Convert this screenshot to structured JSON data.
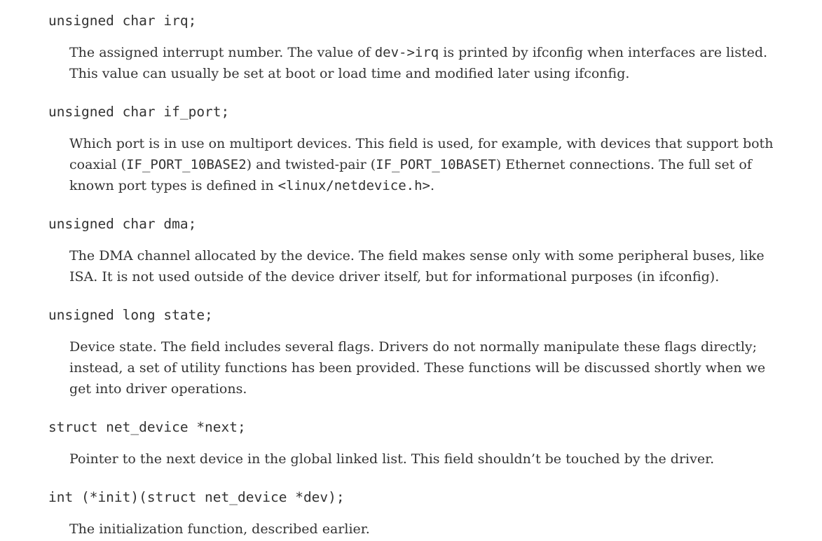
{
  "entries": [
    {
      "term": "unsigned char irq;",
      "lines": [
        [
          "The assigned interrupt number. The value of ",
          "dev->irq",
          " is printed by ifconfig when interfaces are listed."
        ],
        [
          "This value can usually be set at boot or load time and modified later using ifconfig."
        ]
      ]
    },
    {
      "term": "unsigned char if_port;",
      "lines": [
        [
          "Which port is in use on multiport devices. This field is used, for example, with devices that support both"
        ],
        [
          "coaxial (",
          "IF_PORT_10BASE2",
          ") and twisted-pair (",
          "IF_PORT_10BASET",
          ") Ethernet connections. The full set of"
        ],
        [
          "known port types is defined in ",
          "<linux/netdevice.h>",
          "."
        ]
      ]
    },
    {
      "term": "unsigned char dma;",
      "lines": [
        [
          "The DMA channel allocated by the device. The field makes sense only with some peripheral buses, like"
        ],
        [
          "ISA. It is not used outside of the device driver itself, but for informational purposes (in ifconfig)."
        ]
      ]
    },
    {
      "term": "unsigned long state;",
      "lines": [
        [
          "Device state. The field includes several flags. Drivers do not normally manipulate these flags directly;"
        ],
        [
          "instead, a set of utility functions has been provided. These functions will be discussed shortly when we"
        ],
        [
          "get into driver operations."
        ]
      ]
    },
    {
      "term": "struct net_device *next;",
      "lines": [
        [
          "Pointer to the next device in the global linked list. This field shouldn’t be touched by the driver."
        ]
      ]
    },
    {
      "term": "int (*init)(struct net_device *dev);",
      "lines": [
        [
          "The initialization function, described earlier."
        ]
      ]
    }
  ]
}
